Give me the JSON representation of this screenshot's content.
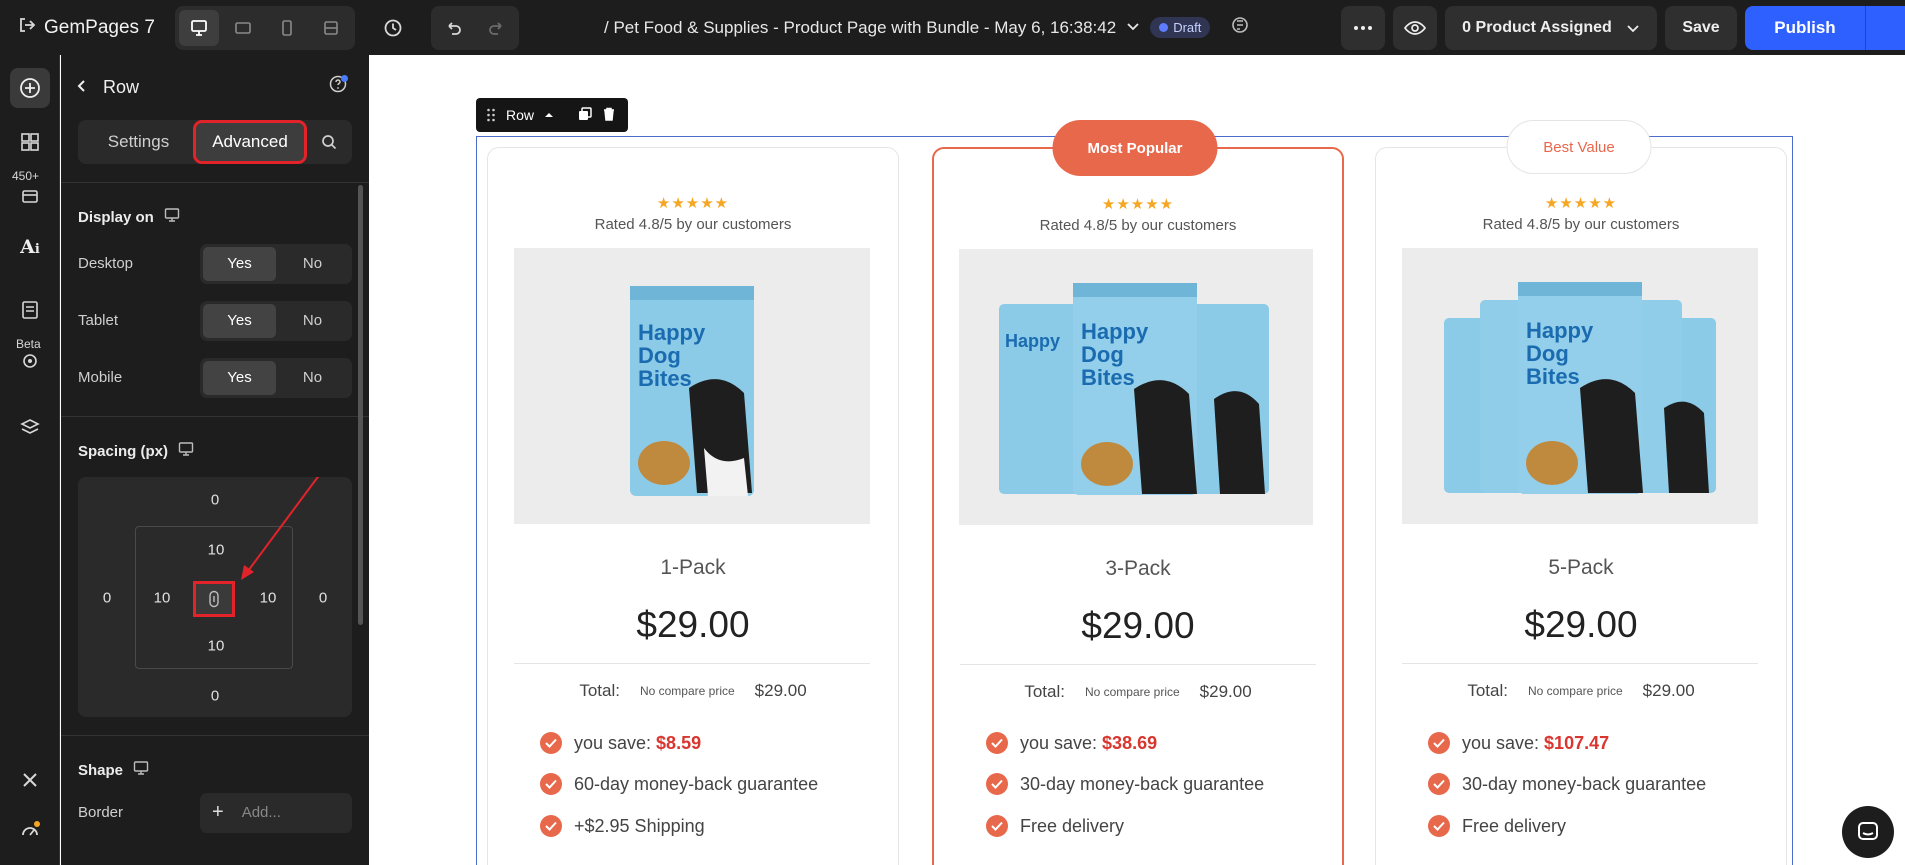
{
  "topbar": {
    "brand": "GemPages 7",
    "page_title": "/ Pet Food & Supplies - Product Page with Bundle - May 6, 16:38:42",
    "status_badge": "Draft",
    "assign_label": "0 Product Assigned",
    "save_label": "Save",
    "publish_label": "Publish"
  },
  "rail": {
    "badge_count": "450+",
    "beta_label": "Beta"
  },
  "panel": {
    "title": "Row",
    "tabs": [
      "Settings",
      "Advanced"
    ],
    "display_on": {
      "title": "Display on",
      "rows": [
        {
          "label": "Desktop",
          "yes": "Yes",
          "no": "No"
        },
        {
          "label": "Tablet",
          "yes": "Yes",
          "no": "No"
        },
        {
          "label": "Mobile",
          "yes": "Yes",
          "no": "No"
        }
      ]
    },
    "spacing": {
      "title": "Spacing (px)",
      "margin_top": "0",
      "margin_left": "0",
      "margin_right": "0",
      "margin_bottom": "0",
      "padding_top": "10",
      "padding_left": "10",
      "padding_right": "10",
      "padding_bottom": "10"
    },
    "shape": {
      "title": "Shape",
      "border_label": "Border",
      "border_placeholder": "Add..."
    }
  },
  "canvas": {
    "row_tag": "Row",
    "cards": [
      {
        "badge": "",
        "stars": "★★★★★",
        "rated": "Rated 4.8/5 by our customers",
        "pack": "1-Pack",
        "price": "$29.00",
        "total_label": "Total:",
        "compare": "No compare price",
        "total": "$29.00",
        "save_prefix": "you save: ",
        "save_amount": "$8.59",
        "feature2": "60-day money-back guarantee",
        "feature3": "+$2.95 Shipping"
      },
      {
        "badge": "Most Popular",
        "stars": "★★★★★",
        "rated": "Rated 4.8/5 by our customers",
        "pack": "3-Pack",
        "price": "$29.00",
        "total_label": "Total:",
        "compare": "No compare price",
        "total": "$29.00",
        "save_prefix": "you save: ",
        "save_amount": "$38.69",
        "feature2": "30-day money-back guarantee",
        "feature3": "Free delivery"
      },
      {
        "badge": "Best Value",
        "stars": "★★★★★",
        "rated": "Rated 4.8/5 by our customers",
        "pack": "5-Pack",
        "price": "$29.00",
        "total_label": "Total:",
        "compare": "No compare price",
        "total": "$29.00",
        "save_prefix": "you save: ",
        "save_amount": "$107.47",
        "feature2": "30-day money-back guarantee",
        "feature3": "Free delivery"
      }
    ],
    "product_label": [
      "Happy",
      "Dog",
      "Bites"
    ]
  },
  "colors": {
    "accent": "#e8684c",
    "publish": "#2e5fff",
    "highlight": "#e2232a",
    "selection": "#4d6bcc"
  }
}
